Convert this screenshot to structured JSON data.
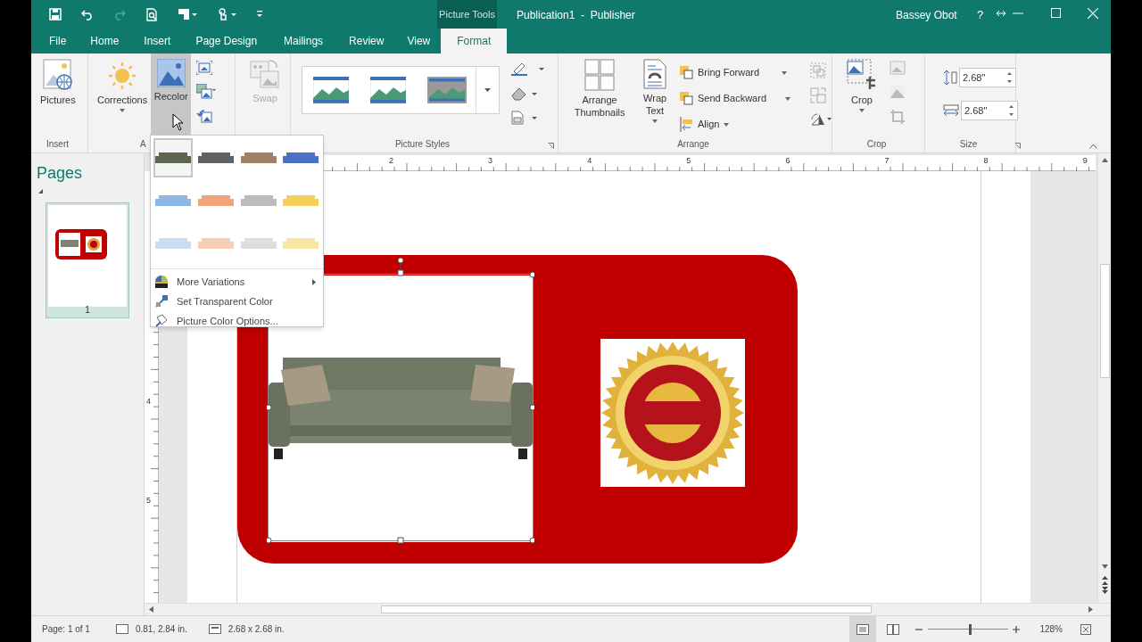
{
  "title_bar": {
    "context_tab": "Picture Tools",
    "title": "Publication1  -  Publisher",
    "user": "Bassey Obot",
    "help": "?"
  },
  "tabs": [
    {
      "label": "File",
      "selected": false
    },
    {
      "label": "Home",
      "selected": false
    },
    {
      "label": "Insert",
      "selected": false
    },
    {
      "label": "Page Design",
      "selected": false
    },
    {
      "label": "Mailings",
      "selected": false
    },
    {
      "label": "Review",
      "selected": false
    },
    {
      "label": "View",
      "selected": false
    },
    {
      "label": "Format",
      "selected": true
    }
  ],
  "ribbon": {
    "insert_group": {
      "label": "Insert",
      "button": "Pictures"
    },
    "adjust_group": {
      "label": "A",
      "corrections": "Corrections",
      "recolor": {
        "label": "Recolor",
        "pressed": true
      },
      "swap": {
        "label": "Swap",
        "disabled": true
      }
    },
    "picture_styles_group": {
      "label": "Picture Styles"
    },
    "arrange_group": {
      "label": "Arrange",
      "arrange_thumbnails": "Arrange Thumbnails",
      "wrap_text": "Wrap Text",
      "bring_forward": "Bring Forward",
      "send_backward": "Send Backward",
      "align": "Align"
    },
    "crop_group": {
      "label": "Crop",
      "button": "Crop"
    },
    "size_group": {
      "label": "Size",
      "height": "2.68\"",
      "width": "2.68\""
    }
  },
  "pages_panel": {
    "title": "Pages",
    "page_number": "1"
  },
  "recolor_menu": {
    "swatches": [
      {
        "color": "#5d6650",
        "selected": true
      },
      {
        "color": "#5f6163",
        "selected": false
      },
      {
        "color": "#a08163",
        "selected": false
      },
      {
        "color": "#4a72c4",
        "selected": false
      },
      {
        "color": "#8fb7e4",
        "selected": false
      },
      {
        "color": "#efa47a",
        "selected": false
      },
      {
        "color": "#bcbcbc",
        "selected": false
      },
      {
        "color": "#f4cf5a",
        "selected": false
      },
      {
        "color": "#c9dcf1",
        "selected": false
      },
      {
        "color": "#f7cdb3",
        "selected": false
      },
      {
        "color": "#dedede",
        "selected": false
      },
      {
        "color": "#f9e6a6",
        "selected": false
      }
    ],
    "items": [
      {
        "label": "More Variations",
        "submenu": true
      },
      {
        "label": "Set Transparent Color",
        "submenu": false
      },
      {
        "label": "Picture Color Options...",
        "submenu": false
      }
    ]
  },
  "rulers": {
    "horizontal": [
      "2",
      "3",
      "4",
      "5",
      "6",
      "7",
      "8",
      "9"
    ],
    "vertical": [
      "4",
      "5"
    ]
  },
  "status_bar": {
    "page": "Page: 1 of 1",
    "position": "0.81, 2.84 in.",
    "size": "2.68 x 2.68 in.",
    "zoom": "128%",
    "zoom_level": {
      "level": 0.52
    }
  }
}
